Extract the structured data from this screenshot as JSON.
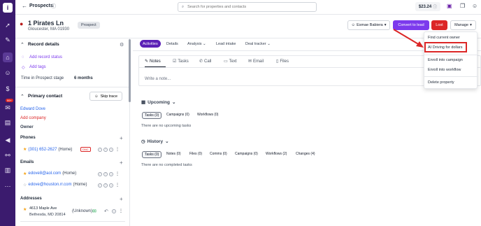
{
  "topbar": {
    "title": "Prospects",
    "search_placeholder": "Search for properties and contacts",
    "balance": "$23.24"
  },
  "header": {
    "address_line1": "1 Pirates Ln",
    "address_line2": "Gloucester, MA 01930",
    "stage": "Prospect",
    "owner": "Esmae Babiera",
    "convert_label": "Convert to lead",
    "lost_label": "Lost",
    "manage_label": "Manage"
  },
  "sidebar": {
    "badge": "99+"
  },
  "left": {
    "record_details_title": "Record details",
    "add_status": "Add record status",
    "add_tags": "Add tags",
    "time_label": "Time in Prospect stage",
    "time_value": "6 months",
    "primary_contact_title": "Primary contact",
    "skip_trace": "Skip trace",
    "contact_name": "Edward Dove",
    "add_company": "Add company",
    "role": "Owner",
    "phones_title": "Phones",
    "phone": {
      "number": "(301) 652-2627",
      "type": "(Home)",
      "badge": "DNC"
    },
    "emails_title": "Emails",
    "emails": [
      {
        "address": "edove8@aol.com",
        "type": "(Home)"
      },
      {
        "address": "edove@houston.rr.com",
        "type": "(Home)"
      }
    ],
    "addresses_title": "Addresses",
    "address": {
      "line1": "4613 Maple Ave",
      "line2": "Bethesda, MD 20814",
      "type": "(Unknown)"
    }
  },
  "main": {
    "tabs": [
      "Activities",
      "Details",
      "Analysis",
      "Lead intake",
      "Deal tracker"
    ],
    "note_tabs": [
      "Notes",
      "Tasks",
      "Call",
      "Text",
      "Email",
      "Files"
    ],
    "note_placeholder": "Write a note...",
    "upcoming_title": "Upcoming",
    "upcoming_chips": [
      "Tasks (0)",
      "Campaigns (0)",
      "Workflows (0)"
    ],
    "upcoming_empty": "There are no upcoming tasks",
    "history_title": "History",
    "history_chips": [
      "Tasks (0)",
      "Notes (0)",
      "Files (0)",
      "Comms (0)",
      "Campaigns (0)",
      "Workflows (2)",
      "Changes (4)"
    ],
    "history_empty": "There are no completed tasks"
  },
  "manage_menu": {
    "items": [
      "Find current owner",
      "AI Driving for dollars",
      "Enroll into campaign",
      "Enroll into workflow",
      "Delete property"
    ]
  },
  "colors": {
    "sidebar": "#3b1b6e",
    "accent": "#7c3aed",
    "danger": "#dc2626",
    "active_tab": "#5b21b6"
  }
}
